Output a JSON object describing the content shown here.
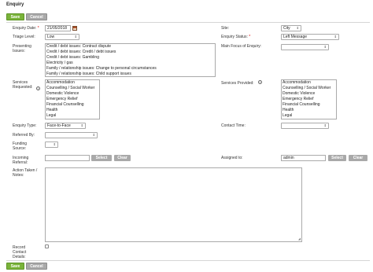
{
  "page": {
    "title": "Enquiry"
  },
  "actions": {
    "save_label": "Save",
    "cancel_label": "Cancel"
  },
  "form": {
    "enquiry_date": {
      "label": "Enquiry Date:",
      "required_mark": "*",
      "value": "21/05/2018"
    },
    "triage_level": {
      "label": "Triage Level:",
      "value": "Low"
    },
    "presenting_issues": {
      "label": "Presenting Issues:",
      "items": [
        "Credit / debt issues: Contract dispute",
        "Credit / debt issues: Credit / debt issues",
        "Credit / debt issues: Gambling",
        "Electricity / gas",
        "Family / relationship issues: Change to personal circumstances",
        "Family / relationship issues: Child support issues"
      ]
    },
    "services_requested": {
      "label": "Services Requested:",
      "info": "i",
      "items": [
        "Accommodation",
        "Counselling / Social Worker",
        "Domestic Violence",
        "Emergency Relief",
        "Financial Counselling",
        "Health",
        "Legal"
      ]
    },
    "enquiry_type": {
      "label": "Enquiry Type:",
      "value": "Face-to-Face"
    },
    "referred_by": {
      "label": "Referred By:",
      "value": ""
    },
    "funding_source": {
      "label": "Funding Source:",
      "value": ""
    },
    "incoming_referral": {
      "label": "Incoming Referral:",
      "value": "",
      "select_label": "Select",
      "clear_label": "Clear"
    },
    "action_taken": {
      "label": "Action Taken / Notes:"
    },
    "record_contact_details": {
      "label": "Record Contact Details:"
    },
    "site": {
      "label": "Site:",
      "value": "City"
    },
    "enquiry_status": {
      "label": "Enquiry Status:",
      "required_mark": "*",
      "value": "Left Message"
    },
    "main_focus": {
      "label": "Main Focus of Enquiry:",
      "value": ""
    },
    "services_provided": {
      "label": "Services Provided:",
      "info": "i",
      "items": [
        "Accommodation",
        "Counselling / Social Worker",
        "Domestic Violence",
        "Emergency Relief",
        "Financial Counselling",
        "Health",
        "Legal"
      ]
    },
    "contact_time": {
      "label": "Contact Time:",
      "value": ""
    },
    "assigned_to": {
      "label": "Assigned to:",
      "value": "admin",
      "select_label": "Select",
      "clear_label": "Clear"
    }
  },
  "icons": {
    "calendar": "calendar-icon",
    "info": "info-icon",
    "dropdown": "chevron-down-icon"
  },
  "colors": {
    "save": "#7ab33a",
    "cancel": "#a9a9a9",
    "required": "#dd0000"
  }
}
